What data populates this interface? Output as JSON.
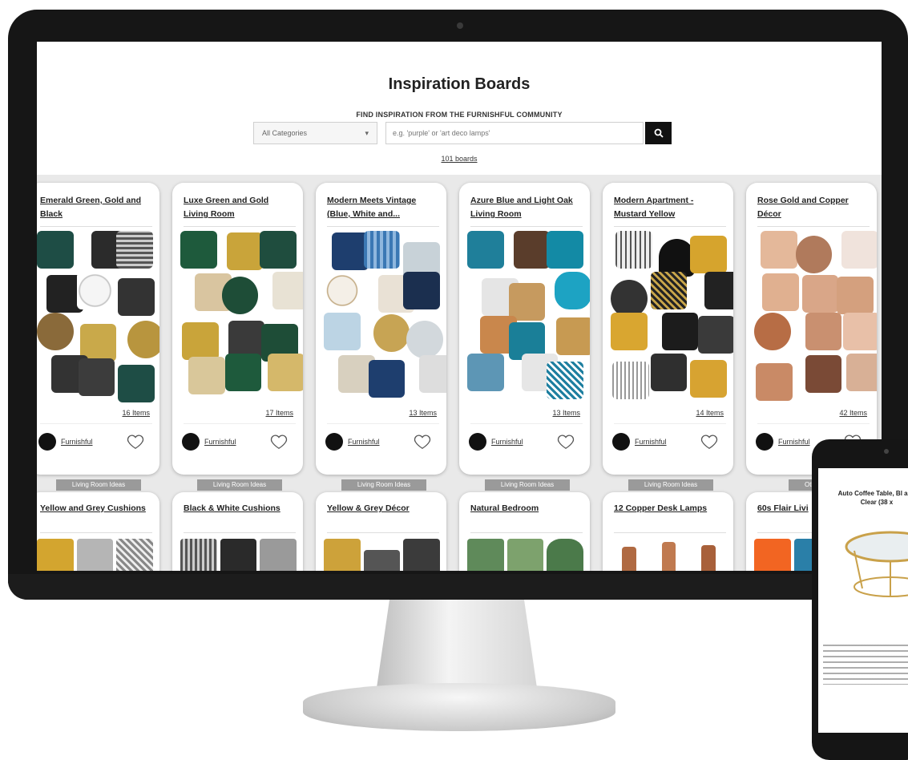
{
  "header": {
    "title": "Inspiration Boards",
    "subtitle": "FIND INSPIRATION FROM THE FURNISHFUL COMMUNITY",
    "category_value": "All Categories",
    "search_placeholder": "e.g. 'purple' or 'art deco lamps'",
    "board_count": "101 boards"
  },
  "colors": {
    "accent": "#111111",
    "tag": "#9a9a9a"
  },
  "boards": [
    {
      "title": "Emerald Green, Gold and Black",
      "items": "16 Items",
      "user": "Furnishful",
      "tag": "Living Room Ideas"
    },
    {
      "title": "Luxe Green and Gold Living Room",
      "items": "17 Items",
      "user": "Furnishful",
      "tag": "Living Room Ideas"
    },
    {
      "title": "Modern Meets Vintage (Blue, White and...",
      "items": "13 Items",
      "user": "Furnishful",
      "tag": "Living Room Ideas"
    },
    {
      "title": "Azure Blue and Light Oak Living Room",
      "items": "13 Items",
      "user": "Furnishful",
      "tag": "Living Room Ideas"
    },
    {
      "title": "Modern Apartment - Mustard Yellow",
      "items": "14 Items",
      "user": "Furnishful",
      "tag": "Living Room Ideas"
    },
    {
      "title": "Rose Gold and Copper Décor",
      "items": "42 Items",
      "user": "Furnishful",
      "tag": "Other"
    }
  ],
  "boards_row2": [
    {
      "title": "Yellow and Grey Cushions"
    },
    {
      "title": "Black & White Cushions"
    },
    {
      "title": "Yellow & Grey Décor"
    },
    {
      "title": "Natural Bedroom"
    },
    {
      "title": "12 Copper Desk Lamps"
    },
    {
      "title": "60s Flair Livi"
    }
  ],
  "phone": {
    "product_title": "Auto Coffee Table, Bl and Clear (38 x"
  }
}
